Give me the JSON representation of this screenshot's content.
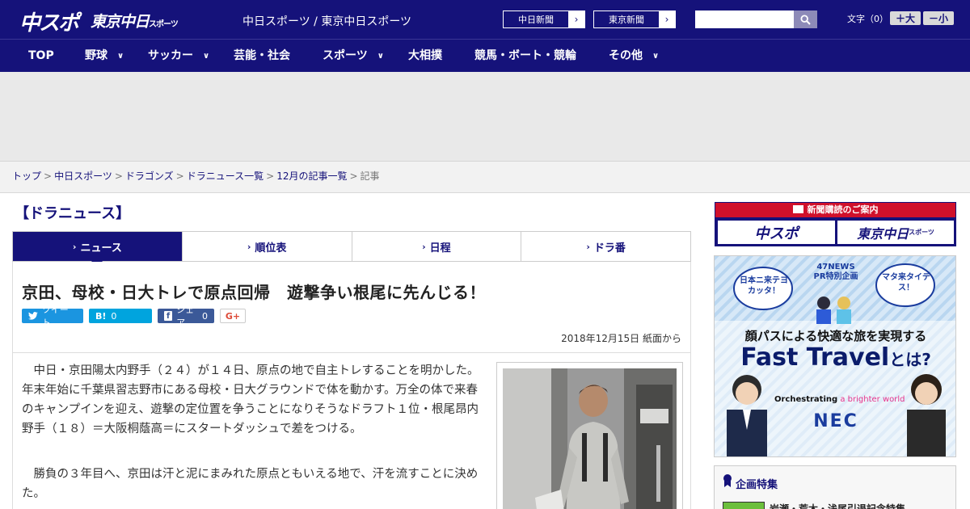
{
  "header": {
    "logo_main": "中スポ",
    "logo_tokyo": "東京中日",
    "logo_tokyo_suffix": "スポーツ",
    "site_names": "中日スポーツ / 東京中日スポーツ",
    "ext_links": [
      "中日新聞",
      "東京新聞"
    ],
    "search_placeholder": "",
    "fontsize_label": "文字（0）",
    "fontsize_up": "＋大",
    "fontsize_down": "－小"
  },
  "nav": {
    "items": [
      {
        "label": "TOP",
        "has_menu": false
      },
      {
        "label": "野球",
        "has_menu": true
      },
      {
        "label": "サッカー",
        "has_menu": true
      },
      {
        "label": "芸能・社会",
        "has_menu": false
      },
      {
        "label": "スポーツ",
        "has_menu": true
      },
      {
        "label": "大相撲",
        "has_menu": false
      },
      {
        "label": "競馬・ボート・競輪",
        "has_menu": false
      },
      {
        "label": "その他",
        "has_menu": true
      }
    ]
  },
  "breadcrumb": {
    "items": [
      "トップ",
      "中日スポーツ",
      "ドラゴンズ",
      "ドラニュース一覧",
      "12月の記事一覧"
    ],
    "current": "記事",
    "separator": ">"
  },
  "section_title": "【ドラニュース】",
  "tabs": [
    "ニュース",
    "順位表",
    "日程",
    "ドラ番"
  ],
  "article": {
    "headline": "京田、母校・日大トレで原点回帰　遊撃争い根尾に先んじる！",
    "share": {
      "tweet": "ツイート",
      "hatena_label": "B!",
      "hatena_count": "0",
      "facebook": "シェア",
      "facebook_count": "0",
      "gplus": "G+"
    },
    "date": "2018年12月15日 紙面から",
    "paragraphs": [
      "中日・京田陽太内野手（２４）が１４日、原点の地で自主トレすることを明かした。年末年始に千葉県習志野市にある母校・日大グラウンドで体を動かす。万全の体で来春のキャンプインを迎え、遊撃の定位置を争うことになりそうなドラフト１位・根尾昂内野手（１８）＝大阪桐蔭高＝にスタートダッシュで差をつける。",
      "勝負の３年目へ、京田は汗と泥にまみれた原点ともいえる地で、汗を流すことに決めた。"
    ]
  },
  "sidebar": {
    "subscription_title": "新聞購読のご案内",
    "subscription_logos": [
      "中スポ",
      "東京中日"
    ],
    "subscription_logo_suffix": "スポーツ",
    "ad": {
      "badge": "47NEWS PR特別企画",
      "bubble_left": "日本ニ来テヨカッタ！",
      "bubble_right": "マタ来タイデス！",
      "headline": "顔パスによる快適な旅を実現する",
      "title_main": "Fast Travel",
      "title_suffix": "とは?",
      "tagline_bold": "Orchestrating",
      "tagline_rest": "a brighter world",
      "brand": "NEC"
    },
    "feature_title": "企画特集",
    "feature_item": "岩瀬・荒木・浅尾引退記念特集"
  },
  "colors": {
    "brand_navy": "#15127a",
    "accent_red": "#d0102b",
    "twitter": "#1b95e0",
    "hatena": "#00a4de",
    "facebook": "#3b5998"
  }
}
